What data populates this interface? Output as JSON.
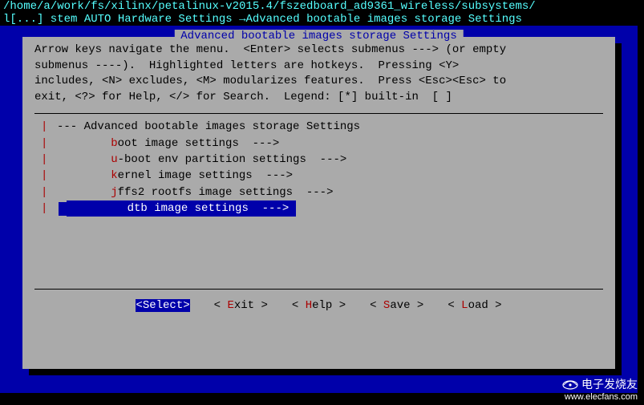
{
  "path": "/home/a/work/fs/xilinx/petalinux-v2015.4/fszedboard_ad9361_wireless/subsystems/",
  "breadcrumb_prefix": "l[...] stem AUTO Hardware Settings ",
  "breadcrumb_arrow": "→",
  "breadcrumb_current": "Advanced bootable images storage Settings",
  "dialog_title": "Advanced bootable images storage Settings",
  "help_text": "Arrow keys navigate the menu.  <Enter> selects submenus ---> (or empty\nsubmenus ----).  Highlighted letters are hotkeys.  Pressing <Y>\nincludes, <N> excludes, <M> modularizes features.  Press <Esc><Esc> to\nexit, <?> for Help, </> for Search.  Legend: [*] built-in  [ ]",
  "menu": {
    "header_prefix": "--- ",
    "header": "Advanced bootable images storage Settings",
    "items": [
      {
        "indent": "        ",
        "hotkey": "b",
        "rest": "oot image settings  --->",
        "selected": false
      },
      {
        "indent": "        ",
        "hotkey": "u",
        "rest": "-boot env partition settings  --->",
        "selected": false
      },
      {
        "indent": "        ",
        "hotkey": "k",
        "rest": "ernel image settings  --->",
        "selected": false
      },
      {
        "indent": "        ",
        "hotkey": "j",
        "rest": "ffs2 rootfs image settings  --->",
        "selected": false
      },
      {
        "indent": "        ",
        "hotkey": "d",
        "rest": "tb image settings  ---> ",
        "selected": true
      }
    ]
  },
  "buttons": [
    {
      "label_pre": "<S",
      "hotkey": "",
      "label_post": "elect>",
      "selected": true,
      "full": "<Select>"
    },
    {
      "label_pre": "< ",
      "hotkey": "E",
      "label_post": "xit >",
      "selected": false
    },
    {
      "label_pre": "< ",
      "hotkey": "H",
      "label_post": "elp >",
      "selected": false
    },
    {
      "label_pre": "< ",
      "hotkey": "S",
      "label_post": "ave >",
      "selected": false
    },
    {
      "label_pre": "< ",
      "hotkey": "L",
      "label_post": "oad >",
      "selected": false
    }
  ],
  "watermark": {
    "cn": "电子发烧友",
    "url": "www.elecfans.com"
  }
}
